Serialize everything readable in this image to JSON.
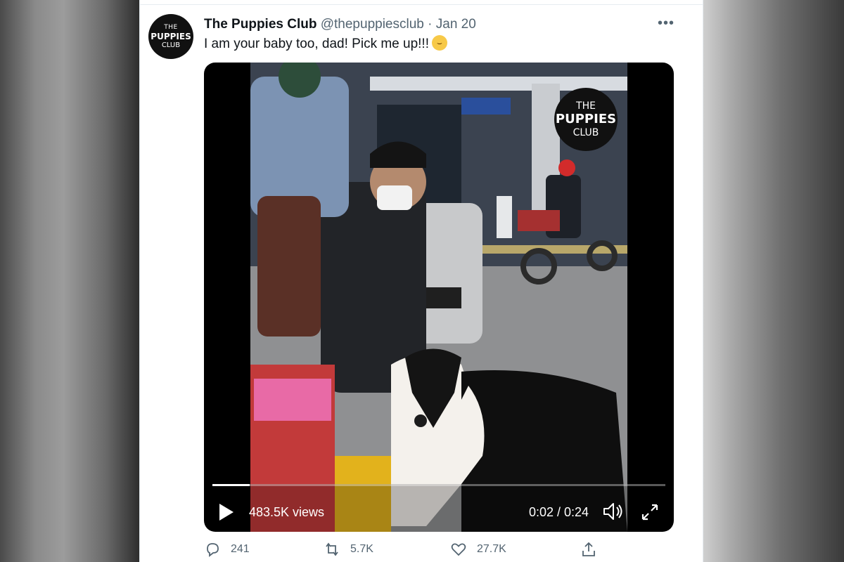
{
  "tweet": {
    "avatar": {
      "line1": "THE",
      "line2": "PUPPIES",
      "line3": "CLUB"
    },
    "display_name": "The Puppies Club",
    "handle": "@thepuppiesclub",
    "separator": "·",
    "date": "Jan 20",
    "more_label": "•••",
    "text": "I am your baby too, dad! Pick me up!!!",
    "emoji": "joy-emoji"
  },
  "media": {
    "watermark": {
      "line1": "THE",
      "line2": "PUPPIES",
      "line3": "CLUB"
    },
    "views": "483.5K views",
    "time": "0:02 / 0:24",
    "progress_fraction": 0.083
  },
  "actions": {
    "replies": "241",
    "retweets": "5.7K",
    "likes": "27.7K"
  },
  "icons": {
    "reply": "reply-icon",
    "retweet": "retweet-icon",
    "like": "heart-icon",
    "share": "share-icon",
    "play": "play-icon",
    "volume": "volume-icon",
    "fullscreen": "fullscreen-icon"
  }
}
